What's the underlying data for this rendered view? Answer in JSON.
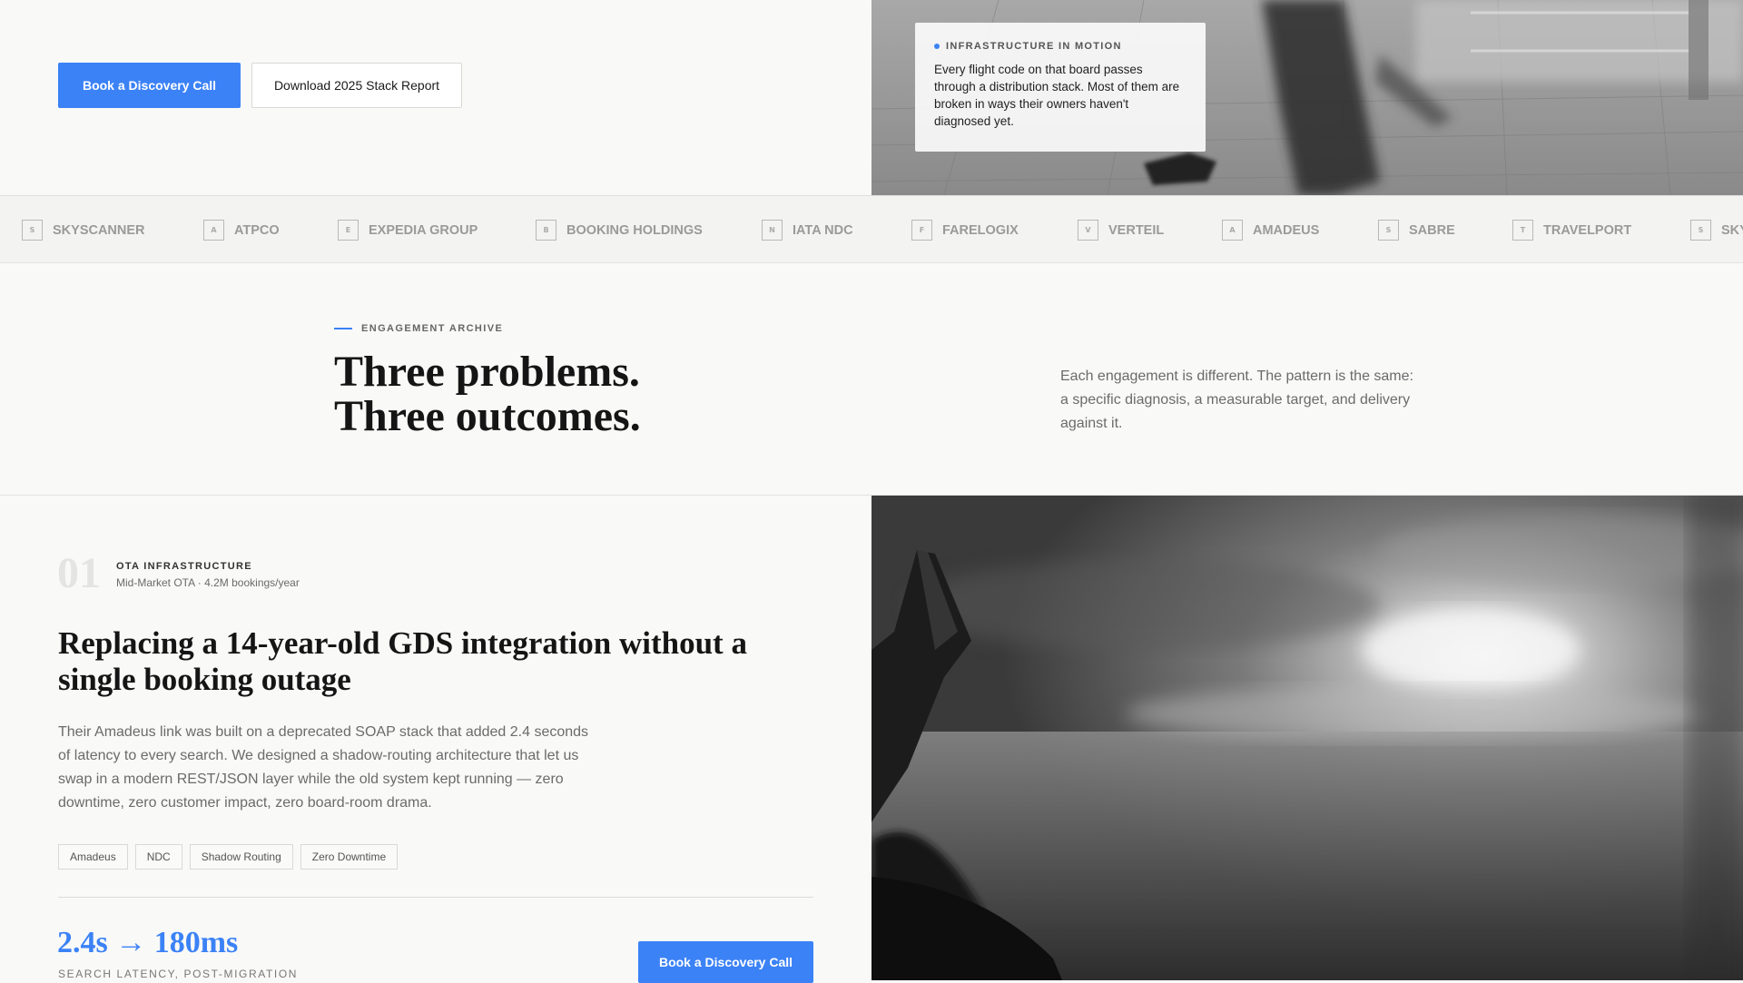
{
  "hero": {
    "primary_cta": "Book a Discovery Call",
    "secondary_cta": "Download 2025 Stack Report",
    "card": {
      "label": "INFRASTRUCTURE IN MOTION",
      "text": "Every flight code on that board passes through a distribution stack. Most of them are broken in ways their owners haven't diagnosed yet."
    }
  },
  "logos": [
    {
      "initial": "S",
      "name": "SKYSCANNER"
    },
    {
      "initial": "A",
      "name": "ATPCO"
    },
    {
      "initial": "E",
      "name": "EXPEDIA GROUP"
    },
    {
      "initial": "B",
      "name": "BOOKING HOLDINGS"
    },
    {
      "initial": "N",
      "name": "IATA NDC"
    },
    {
      "initial": "F",
      "name": "FARELOGIX"
    },
    {
      "initial": "V",
      "name": "VERTEIL"
    },
    {
      "initial": "A",
      "name": "AMADEUS"
    },
    {
      "initial": "S",
      "name": "SABRE"
    },
    {
      "initial": "T",
      "name": "TRAVELPORT"
    },
    {
      "initial": "S",
      "name": "SKYSCANNER"
    }
  ],
  "archive": {
    "eyebrow": "ENGAGEMENT ARCHIVE",
    "title_line1": "Three problems.",
    "title_line2": "Three outcomes.",
    "description": "Each engagement is different. The pattern is the same: a specific diagnosis, a measurable target, and delivery against it."
  },
  "case": {
    "number": "01",
    "category": "OTA INFRASTRUCTURE",
    "client": "Mid-Market OTA · 4.2M bookings/year",
    "title": "Replacing a 14-year-old GDS integration without a single booking outage",
    "body": "Their Amadeus link was built on a deprecated SOAP stack that added 2.4 seconds of latency to every search. We designed a shadow-routing architecture that let us swap in a modern REST/JSON layer while the old system kept running — zero downtime, zero customer impact, zero board-room drama.",
    "tags": [
      "Amadeus",
      "NDC",
      "Shadow Routing",
      "Zero Downtime"
    ],
    "metric": "2.4s → 180ms",
    "metric_label": "SEARCH LATENCY, POST-MIGRATION",
    "cta": "Book a Discovery Call"
  },
  "colors": {
    "accent": "#3b82f6",
    "text": "#151515",
    "muted": "#6b6b6b",
    "background": "#f9f9f8"
  }
}
